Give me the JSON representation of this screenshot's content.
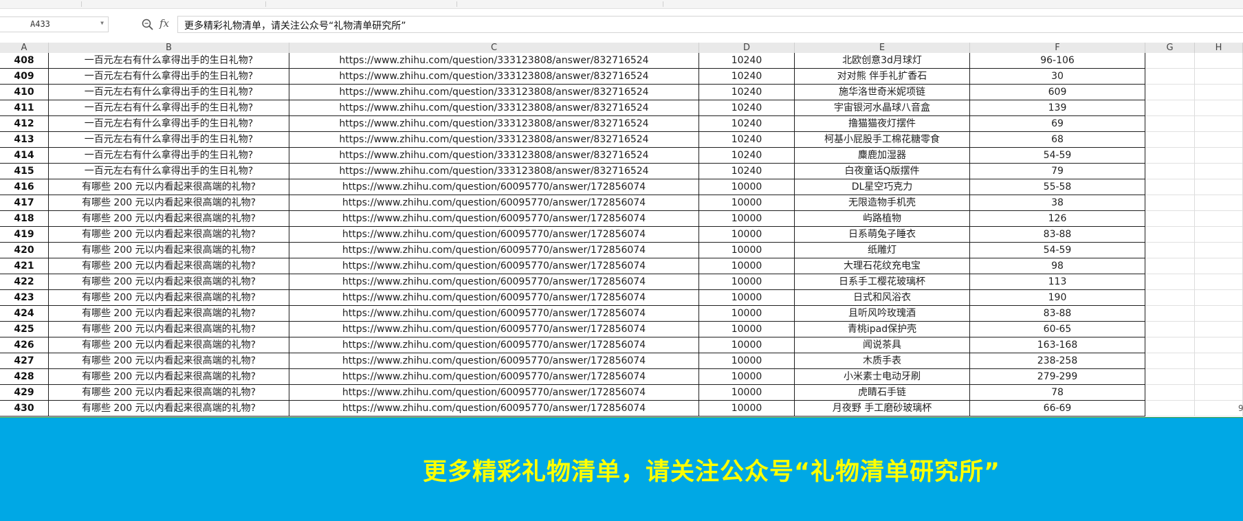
{
  "name_box": {
    "value": "A433"
  },
  "formula_bar": {
    "fx_label": "fx",
    "content": "更多精彩礼物清单，请关注公众号“礼物清单研究所”"
  },
  "columns": [
    "A",
    "B",
    "C",
    "D",
    "E",
    "F",
    "G",
    "H"
  ],
  "rows": [
    {
      "num": "408",
      "question": "一百元左右有什么拿得出手的生日礼物?",
      "url": "https://www.zhihu.com/question/333123808/answer/832716524",
      "likes": "10240",
      "gift": "北欧创意3d月球灯",
      "price": "96-106"
    },
    {
      "num": "409",
      "question": "一百元左右有什么拿得出手的生日礼物?",
      "url": "https://www.zhihu.com/question/333123808/answer/832716524",
      "likes": "10240",
      "gift": "对对熊 伴手礼扩香石",
      "price": "30"
    },
    {
      "num": "410",
      "question": "一百元左右有什么拿得出手的生日礼物?",
      "url": "https://www.zhihu.com/question/333123808/answer/832716524",
      "likes": "10240",
      "gift": "施华洛世奇米妮项链",
      "price": "609"
    },
    {
      "num": "411",
      "question": "一百元左右有什么拿得出手的生日礼物?",
      "url": "https://www.zhihu.com/question/333123808/answer/832716524",
      "likes": "10240",
      "gift": "宇宙银河水晶球八音盒",
      "price": "139"
    },
    {
      "num": "412",
      "question": "一百元左右有什么拿得出手的生日礼物?",
      "url": "https://www.zhihu.com/question/333123808/answer/832716524",
      "likes": "10240",
      "gift": "撸猫猫夜灯摆件",
      "price": "69"
    },
    {
      "num": "413",
      "question": "一百元左右有什么拿得出手的生日礼物?",
      "url": "https://www.zhihu.com/question/333123808/answer/832716524",
      "likes": "10240",
      "gift": "柯基小屁股手工棉花糖零食",
      "price": "68"
    },
    {
      "num": "414",
      "question": "一百元左右有什么拿得出手的生日礼物?",
      "url": "https://www.zhihu.com/question/333123808/answer/832716524",
      "likes": "10240",
      "gift": "麋鹿加湿器",
      "price": "54-59"
    },
    {
      "num": "415",
      "question": "一百元左右有什么拿得出手的生日礼物?",
      "url": "https://www.zhihu.com/question/333123808/answer/832716524",
      "likes": "10240",
      "gift": "白夜童话Q版摆件",
      "price": "79"
    },
    {
      "num": "416",
      "question": "有哪些 200 元以内看起来很高端的礼物?",
      "url": "https://www.zhihu.com/question/60095770/answer/172856074",
      "likes": "10000",
      "gift": "DL星空巧克力",
      "price": "55-58"
    },
    {
      "num": "417",
      "question": "有哪些 200 元以内看起来很高端的礼物?",
      "url": "https://www.zhihu.com/question/60095770/answer/172856074",
      "likes": "10000",
      "gift": "无限造物手机壳",
      "price": "38"
    },
    {
      "num": "418",
      "question": "有哪些 200 元以内看起来很高端的礼物?",
      "url": "https://www.zhihu.com/question/60095770/answer/172856074",
      "likes": "10000",
      "gift": "屿路植物",
      "price": "126"
    },
    {
      "num": "419",
      "question": "有哪些 200 元以内看起来很高端的礼物?",
      "url": "https://www.zhihu.com/question/60095770/answer/172856074",
      "likes": "10000",
      "gift": "日系萌兔子睡衣",
      "price": "83-88"
    },
    {
      "num": "420",
      "question": "有哪些 200 元以内看起来很高端的礼物?",
      "url": "https://www.zhihu.com/question/60095770/answer/172856074",
      "likes": "10000",
      "gift": "纸雕灯",
      "price": "54-59"
    },
    {
      "num": "421",
      "question": "有哪些 200 元以内看起来很高端的礼物?",
      "url": "https://www.zhihu.com/question/60095770/answer/172856074",
      "likes": "10000",
      "gift": "大理石花纹充电宝",
      "price": "98"
    },
    {
      "num": "422",
      "question": "有哪些 200 元以内看起来很高端的礼物?",
      "url": "https://www.zhihu.com/question/60095770/answer/172856074",
      "likes": "10000",
      "gift": "日系手工樱花玻璃杯",
      "price": "113"
    },
    {
      "num": "423",
      "question": "有哪些 200 元以内看起来很高端的礼物?",
      "url": "https://www.zhihu.com/question/60095770/answer/172856074",
      "likes": "10000",
      "gift": "日式和风浴衣",
      "price": "190"
    },
    {
      "num": "424",
      "question": "有哪些 200 元以内看起来很高端的礼物?",
      "url": "https://www.zhihu.com/question/60095770/answer/172856074",
      "likes": "10000",
      "gift": "且听风吟玫瑰酒",
      "price": "83-88"
    },
    {
      "num": "425",
      "question": "有哪些 200 元以内看起来很高端的礼物?",
      "url": "https://www.zhihu.com/question/60095770/answer/172856074",
      "likes": "10000",
      "gift": "青桃ipad保护壳",
      "price": "60-65"
    },
    {
      "num": "426",
      "question": "有哪些 200 元以内看起来很高端的礼物?",
      "url": "https://www.zhihu.com/question/60095770/answer/172856074",
      "likes": "10000",
      "gift": "闻说茶具",
      "price": "163-168"
    },
    {
      "num": "427",
      "question": "有哪些 200 元以内看起来很高端的礼物?",
      "url": "https://www.zhihu.com/question/60095770/answer/172856074",
      "likes": "10000",
      "gift": "木质手表",
      "price": "238-258"
    },
    {
      "num": "428",
      "question": "有哪些 200 元以内看起来很高端的礼物?",
      "url": "https://www.zhihu.com/question/60095770/answer/172856074",
      "likes": "10000",
      "gift": "小米素士电动牙刷",
      "price": "279-299"
    },
    {
      "num": "429",
      "question": "有哪些 200 元以内看起来很高端的礼物?",
      "url": "https://www.zhihu.com/question/60095770/answer/172856074",
      "likes": "10000",
      "gift": "虎睛石手链",
      "price": "78"
    },
    {
      "num": "430",
      "question": "有哪些 200 元以内看起来很高端的礼物?",
      "url": "https://www.zhihu.com/question/60095770/answer/172856074",
      "likes": "10000",
      "gift": "月夜野 手工磨砂玻璃杯",
      "price": "66-69"
    }
  ],
  "stray_mark": "9",
  "banner": {
    "text": "更多精彩礼物清单，请关注公众号“礼物清单研究所”",
    "background": "#00a8e5",
    "text_color": "#ffff00"
  },
  "icons": {
    "zoom": "zoom-formula-icon",
    "fx": "fx-icon"
  }
}
